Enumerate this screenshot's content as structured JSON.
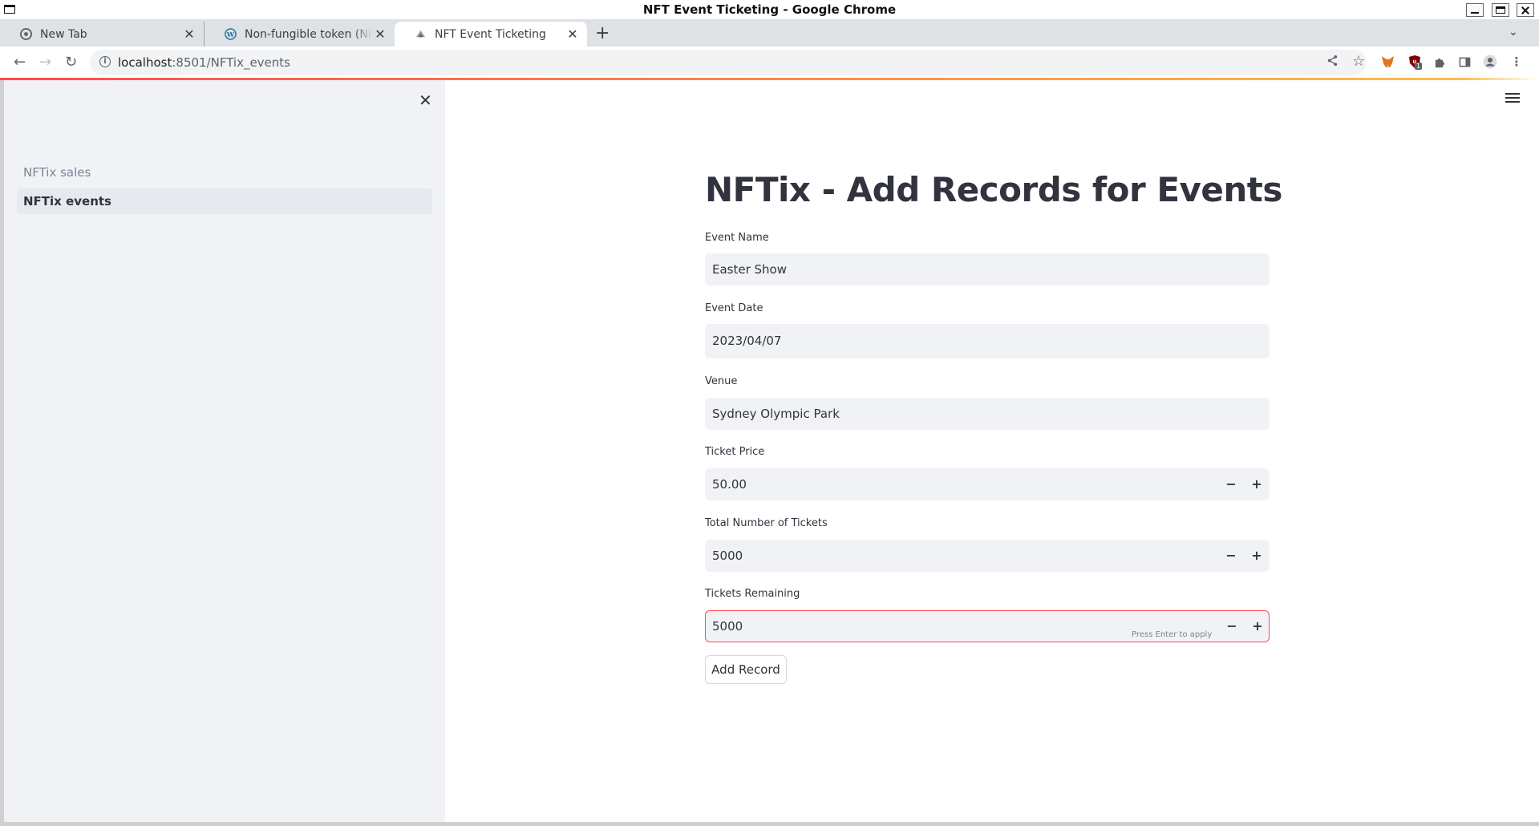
{
  "window": {
    "title": "NFT Event Ticketing - Google Chrome"
  },
  "tabs": [
    {
      "label": "New Tab",
      "icon": "chrome-icon",
      "active": false
    },
    {
      "label": "Non-fungible token (NFT) a",
      "icon": "wordpress-icon",
      "active": false
    },
    {
      "label": "NFT Event Ticketing",
      "icon": "streamlit-icon",
      "active": true
    }
  ],
  "toolbar": {
    "url_host": "localhost",
    "url_path": ":8501/NFTix_events"
  },
  "extensions": {
    "badge_count": "1"
  },
  "sidebar": {
    "items": [
      {
        "label": "NFTix sales",
        "selected": false
      },
      {
        "label": "NFTix events",
        "selected": true
      }
    ]
  },
  "main": {
    "title": "NFTix - Add Records for Events",
    "fields": {
      "event_name": {
        "label": "Event Name",
        "value": "Easter Show"
      },
      "event_date": {
        "label": "Event Date",
        "value": "2023/04/07"
      },
      "venue": {
        "label": "Venue",
        "value": "Sydney Olympic Park"
      },
      "ticket_price": {
        "label": "Ticket Price",
        "value": "50.00"
      },
      "total_tickets": {
        "label": "Total Number of Tickets",
        "value": "5000"
      },
      "tickets_remaining": {
        "label": "Tickets Remaining",
        "value": "5000",
        "hint": "Press Enter to apply"
      }
    },
    "minus_symbol": "−",
    "plus_symbol": "+",
    "submit_label": "Add Record"
  },
  "colors": {
    "accent": "#ff4b4b",
    "sidebar_bg": "#f0f2f6",
    "text": "#31333f"
  }
}
